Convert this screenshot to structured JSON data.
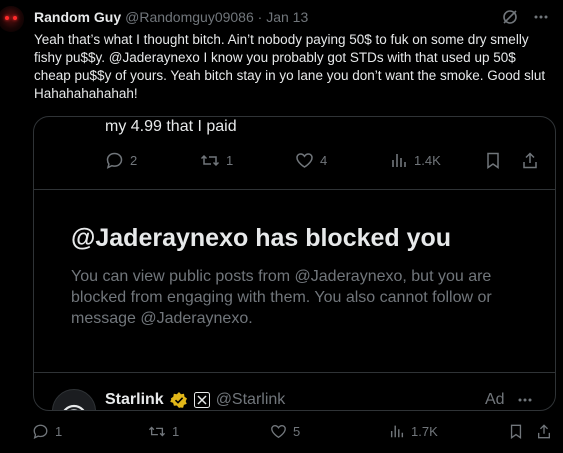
{
  "tweet": {
    "author_name": "Random Guy",
    "author_handle": "@Randomguy09086 · Jan 13",
    "text": "Yeah that’s what I thought bitch. Ain’t nobody paying 50$ to fuk on some dry smelly fishy pu$$y. @Jaderaynexo I know you probably got STDs with that used up 50$ cheap pu$$y of yours. Yeah bitch stay in yo lane you don’t want the smoke. Good slut Hahahahahahah!",
    "icons": [
      "grok-icon",
      "more-icon"
    ]
  },
  "quoted": {
    "text_fragment": "my 4.99 that I paid",
    "actions": {
      "replies": "2",
      "reposts": "1",
      "likes": "4",
      "views": "1.4K"
    },
    "blocked_title": "@Jaderaynexo has blocked you",
    "blocked_body": "You can view public posts from @Jaderaynexo, but you are blocked from engaging with them. You also cannot follow or message @Jaderaynexo.",
    "ad": {
      "name": "Starlink",
      "handle": "@Starlink",
      "label": "Ad"
    }
  },
  "actions": {
    "replies": "1",
    "reposts": "1",
    "likes": "5",
    "views": "1.7K"
  },
  "colors": {
    "background": "#000000",
    "text": "#e7e9ea",
    "muted": "#71767b",
    "border": "#2f3336",
    "verified": "#e2b719"
  }
}
